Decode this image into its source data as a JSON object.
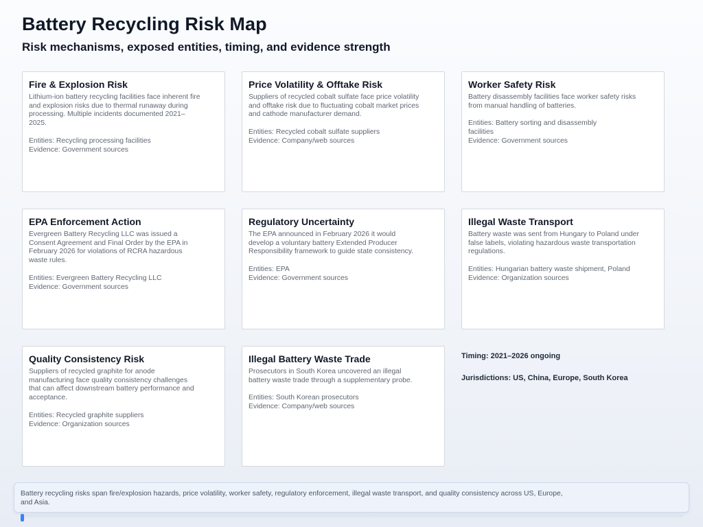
{
  "header": {
    "title": "Battery Recycling Risk Map",
    "subtitle": "Risk mechanisms, exposed entities, timing, and evidence strength"
  },
  "cards": [
    {
      "title": "Fire & Explosion Risk",
      "description": "Lithium-ion battery recycling facilities face inherent fire and explosion risks due to thermal runaway during processing. Multiple incidents documented 2021–2025.",
      "entities": "Entities: Recycling processing facilities",
      "evidence": "Evidence: Government sources"
    },
    {
      "title": "Price Volatility & Offtake Risk",
      "description": "Suppliers of recycled cobalt sulfate face price volatility and offtake risk due to fluctuating cobalt market prices and cathode manufacturer demand.",
      "entities": "Entities: Recycled cobalt sulfate suppliers",
      "evidence": "Evidence: Company/web sources"
    },
    {
      "title": "Worker Safety Risk",
      "description": "Battery disassembly facilities face worker safety risks from manual handling of batteries.",
      "entities": "Entities: Battery sorting and disassembly facilities",
      "evidence": "Evidence: Government sources"
    },
    {
      "title": "EPA Enforcement Action",
      "description": "Evergreen Battery Recycling LLC was issued a Consent Agreement and Final Order by the EPA in February 2026 for violations of RCRA hazardous waste rules.",
      "entities": "Entities: Evergreen Battery Recycling LLC",
      "evidence": "Evidence: Government sources"
    },
    {
      "title": "Regulatory Uncertainty",
      "description": "The EPA announced in February 2026 it would develop a voluntary battery Extended Producer Responsibility framework to guide state consistency.",
      "entities": "Entities: EPA",
      "evidence": "Evidence: Government sources"
    },
    {
      "title": "Illegal Waste Transport",
      "description": "Battery waste was sent from Hungary to Poland under false labels, violating hazardous waste transportation regulations.",
      "entities": "Entities: Hungarian battery waste shipment, Poland",
      "evidence": "Evidence: Organization sources"
    },
    {
      "title": "Quality Consistency Risk",
      "description": "Suppliers of recycled graphite for anode manufacturing face quality consistency challenges that can affect downstream battery performance and acceptance.",
      "entities": "Entities: Recycled graphite suppliers",
      "evidence": "Evidence: Organization sources"
    },
    {
      "title": "Illegal Battery Waste Trade",
      "description": "Prosecutors in South Korea uncovered an illegal battery waste trade through a supplementary probe.",
      "entities": "Entities: South Korean prosecutors",
      "evidence": "Evidence: Company/web sources"
    }
  ],
  "side_notes": {
    "timing": "Timing: 2021–2026 ongoing",
    "jurisdictions": "Jurisdictions: US, China, Europe, South Korea"
  },
  "summary": {
    "text": "Battery recycling risks span fire/explosion hazards, price volatility, worker safety, regulatory enforcement, illegal waste transport, and quality consistency across US, Europe, and Asia."
  }
}
